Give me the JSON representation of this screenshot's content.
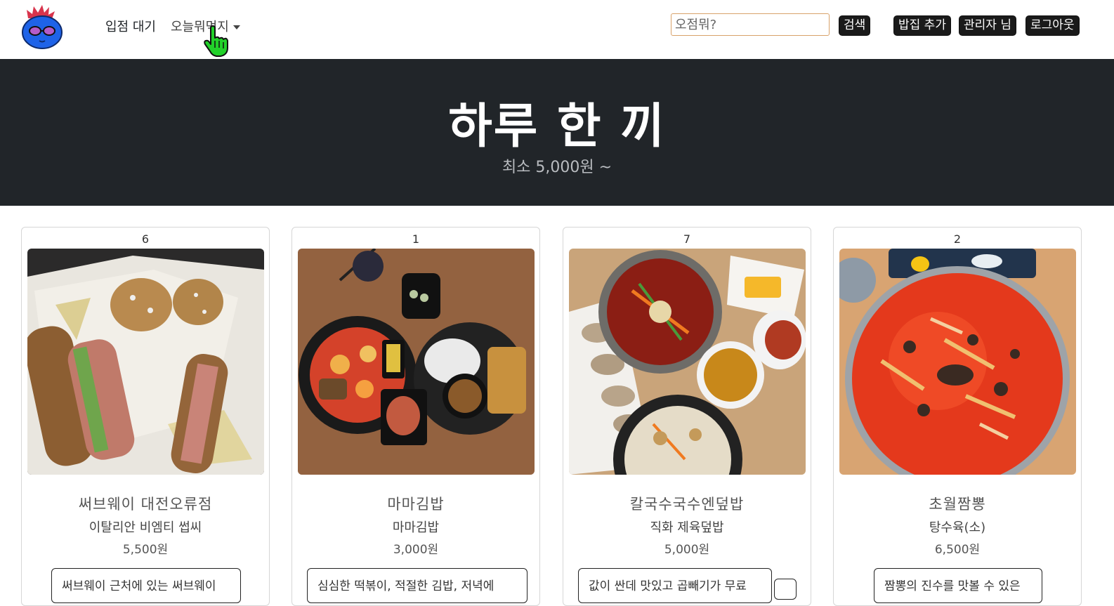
{
  "navbar": {
    "links": [
      {
        "label": "입점 대기"
      },
      {
        "label": "오늘뭐먹지"
      }
    ],
    "search_placeholder": "오점뭐?",
    "search_button": "검색",
    "buttons": {
      "add": "밥집 추가",
      "admin": "관리자 님",
      "logout": "로그아웃"
    }
  },
  "hero": {
    "title": "하루 한 끼",
    "subtitle": "최소 5,000원 ~"
  },
  "cards": [
    {
      "rank": "6",
      "name": "써브웨이 대전오류점",
      "menu": "이탈리안 비엠티 썹씨",
      "price": "5,500원",
      "review": "써브웨이 근처에 있는 써브웨이"
    },
    {
      "rank": "1",
      "name": "마마김밥",
      "menu": "마마김밥",
      "price": "3,000원",
      "review": "심심한 떡볶이, 적절한 김밥, 저녁에"
    },
    {
      "rank": "7",
      "name": "칼국수국수엔덮밥",
      "menu": "직화 제육덮밥",
      "price": "5,000원",
      "review": "값이 싼데 맛있고 곱빼기가 무료"
    },
    {
      "rank": "2",
      "name": "초월짬뽕",
      "menu": "탕수육(소)",
      "price": "6,500원",
      "review": "짬뽕의 진수를 맛볼 수 있은"
    }
  ]
}
